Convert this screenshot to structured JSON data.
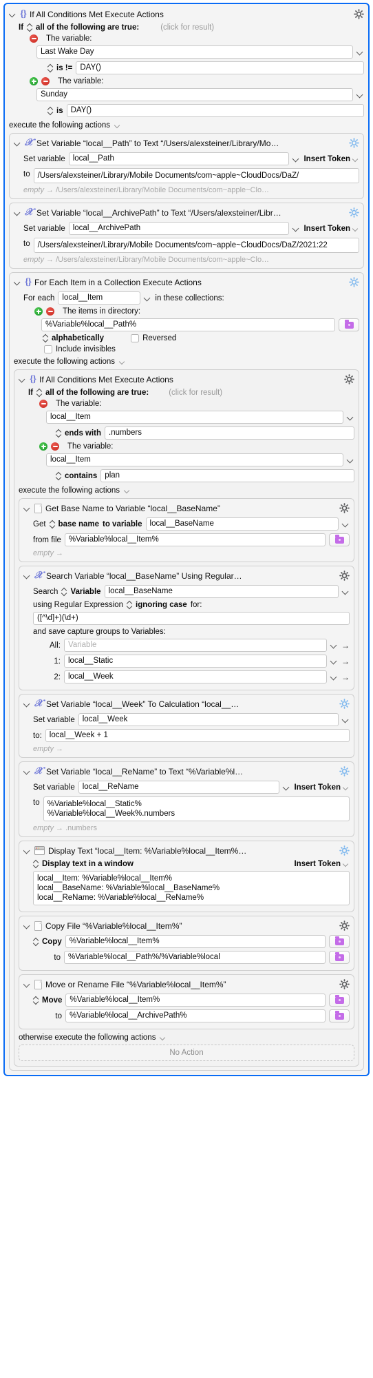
{
  "colors": {
    "selection_border": "#0a6cf5",
    "token_icon": "#6f78d8",
    "folder_icon": "#c46ce8",
    "add_badge": "#19962a",
    "remove_badge": "#c9281f"
  },
  "outer_if": {
    "title": "If All Conditions Met Execute Actions",
    "icon": "braces-icon",
    "gear": "gear-icon",
    "condition_header": {
      "if_label": "If",
      "mode": "all of the following are true:",
      "hint": "(click for result)"
    },
    "conditions": [
      {
        "remove": "⊖",
        "label": "The variable:",
        "variable": "Last Wake Day",
        "operator": "is !=",
        "value": "DAY()",
        "has_add": false
      },
      {
        "label": "The variable:",
        "variable": "Sunday",
        "operator": "is",
        "value": "DAY()",
        "has_add": true
      }
    ],
    "execute_label": "execute the following actions"
  },
  "set_path": {
    "title": "Set Variable “local__Path” to Text “/Users/alexsteiner/Library/Mo…",
    "icon": "variable-x-icon",
    "set_variable_label": "Set variable",
    "variable_name": "local__Path",
    "insert_token": "Insert Token",
    "to_label": "to",
    "to_value": "/Users/alexsteiner/Library/Mobile Documents/com~apple~CloudDocs/DaZ/",
    "result_from": "empty",
    "result_arrow": "→",
    "result_to": "/Users/alexsteiner/Library/Mobile Documents/com~apple~Clo…"
  },
  "set_archive": {
    "title": "Set Variable “local__ArchivePath” to Text “/Users/alexsteiner/Libr…",
    "icon": "variable-x-icon",
    "set_variable_label": "Set variable",
    "variable_name": "local__ArchivePath",
    "insert_token": "Insert Token",
    "to_label": "to",
    "to_value": "/Users/alexsteiner/Library/Mobile Documents/com~apple~CloudDocs/DaZ/2021:22",
    "result_from": "empty",
    "result_arrow": "→",
    "result_to": "/Users/alexsteiner/Library/Mobile Documents/com~apple~Clo…"
  },
  "for_each": {
    "title": "For Each Item in a Collection Execute Actions",
    "icon": "braces-icon",
    "for_each_label": "For each",
    "loop_variable": "local__Item",
    "in_collections_label": "in these collections:",
    "collection_label": "The items in directory:",
    "directory_value": "%Variable%local__Path%",
    "sort_label": "alphabetically",
    "reversed_label": "Reversed",
    "reversed_checked": false,
    "include_invisibles_label": "Include invisibles",
    "include_invisibles_checked": false,
    "execute_label": "execute the following actions"
  },
  "inner_if": {
    "title": "If All Conditions Met Execute Actions",
    "icon": "braces-icon",
    "condition_header": {
      "if_label": "If",
      "mode": "all of the following are true:",
      "hint": "(click for result)"
    },
    "conditions": [
      {
        "label": "The variable:",
        "variable": "local__Item",
        "operator": "ends with",
        "value": ".numbers",
        "has_add": false
      },
      {
        "label": "The variable:",
        "variable": "local__Item",
        "operator": "contains",
        "value": "plan",
        "has_add": true
      }
    ],
    "execute_label": "execute the following actions",
    "otherwise_label": "otherwise execute the following actions",
    "no_action_label": "No Action"
  },
  "get_base_name": {
    "title": "Get Base Name to Variable “local__BaseName”",
    "icon": "document-icon",
    "get_label": "Get",
    "mode": "base name",
    "to_variable_label": "to variable",
    "variable_name": "local__BaseName",
    "from_file_label": "from file",
    "from_file_value": "%Variable%local__Item%",
    "result_from": "empty",
    "result_arrow": "→"
  },
  "search_regex": {
    "title": "Search Variable “local__BaseName” Using Regular…",
    "icon": "variable-x-icon",
    "search_label": "Search",
    "source_type": "Variable",
    "source_variable": "local__BaseName",
    "using_label": "using Regular Expression",
    "case_mode": "ignoring case",
    "for_label": "for:",
    "pattern": "([^\\d]+)(\\d+)",
    "capture_label": "and save capture groups to Variables:",
    "captures": [
      {
        "index": "All:",
        "value": "",
        "placeholder": "Variable"
      },
      {
        "index": "1:",
        "value": "local__Static",
        "placeholder": "Variable"
      },
      {
        "index": "2:",
        "value": "local__Week",
        "placeholder": "Variable"
      }
    ]
  },
  "set_week": {
    "title": "Set Variable “local__Week” To Calculation “local__…",
    "icon": "variable-x-icon",
    "set_variable_label": "Set variable",
    "variable_name": "local__Week",
    "to_label": "to:",
    "to_value": "local__Week + 1",
    "result_from": "empty",
    "result_arrow": "→"
  },
  "set_rename": {
    "title": "Set Variable “local__ReName” to Text “%Variable%l…",
    "icon": "variable-x-icon",
    "set_variable_label": "Set variable",
    "variable_name": "local__ReName",
    "insert_token": "Insert Token",
    "to_label": "to",
    "to_value": "%Variable%local__Static%\n%Variable%local__Week%.numbers",
    "result_from": "empty",
    "result_arrow": "→",
    "result_to": ".numbers"
  },
  "display_text": {
    "title": "Display Text “local__Item: %Variable%local__Item%…",
    "icon": "window-icon",
    "mode": "Display text in a window",
    "insert_token": "Insert Token",
    "body": "local__Item: %Variable%local__Item%\nlocal__BaseName: %Variable%local__BaseName%\nlocal__ReName: %Variable%local__ReName%"
  },
  "copy_file": {
    "title": "Copy File “%Variable%local__Item%”",
    "icon": "document-icon",
    "operation": "Copy",
    "source": "%Variable%local__Item%",
    "to_label": "to",
    "destination": "%Variable%local__Path%/%Variable%local"
  },
  "move_file": {
    "title": "Move or Rename File “%Variable%local__Item%”",
    "icon": "document-icon",
    "operation": "Move",
    "source": "%Variable%local__Item%",
    "to_label": "to",
    "destination": "%Variable%local__ArchivePath%"
  }
}
